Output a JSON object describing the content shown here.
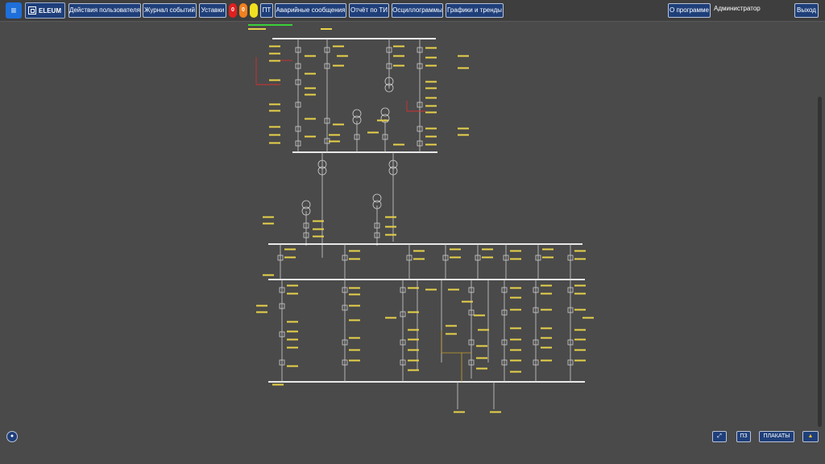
{
  "toolbar": {
    "menu_icon": "≡",
    "logo_text": "ELEUM",
    "user_actions": "Действия пользователя",
    "event_log": "Журнал событий",
    "settings": "Уставки",
    "indicators": [
      {
        "label": "0",
        "color": "#e02020"
      },
      {
        "label": "0",
        "color": "#f08020"
      },
      {
        "label": "",
        "color": "#f0e020"
      }
    ],
    "pt": "ПТ",
    "alarms": "Аварийные сообщения",
    "ti_report": "Отчёт по ТИ",
    "oscillograms": "Осциллограммы",
    "charts_trends": "Графики и тренды",
    "about": "О программе",
    "user": "Администратор",
    "logout": "Выход"
  },
  "bottom": {
    "pz": "ПЗ",
    "posters": "ПЛАКАТЫ"
  },
  "colors": {
    "accent": "#1e6fd9",
    "button_bg": "#1f3f7a",
    "bus": "#ffffff",
    "label_yellow": "#e8d24a",
    "label_green": "#3ad13a",
    "line_red": "#d03030",
    "line_grey": "#cfcfcf"
  }
}
